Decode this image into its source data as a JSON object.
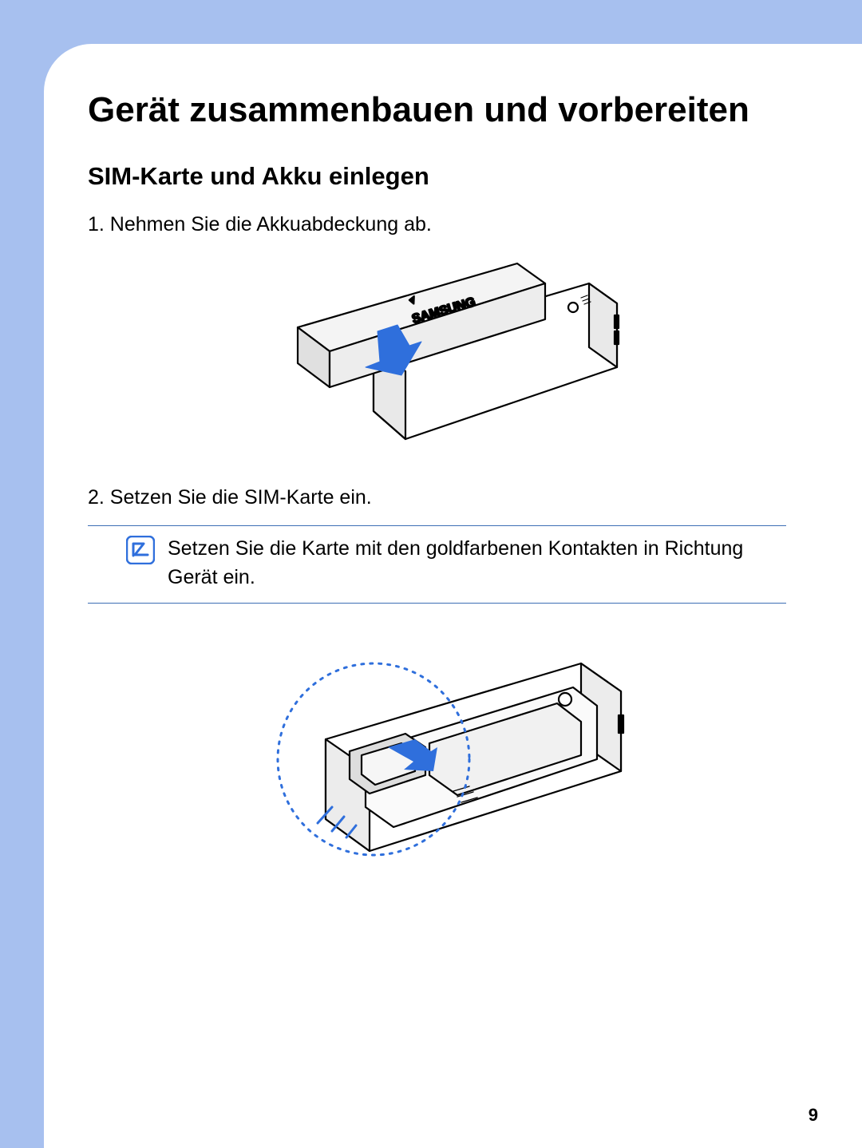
{
  "title": "Gerät zusammenbauen und vorbereiten",
  "subtitle": "SIM-Karte und Akku einlegen",
  "steps": [
    "1. Nehmen Sie die Akkuabdeckung ab.",
    "2. Setzen Sie die SIM-Karte ein."
  ],
  "note": "Setzen Sie die Karte mit den goldfarbenen Kontakten in Richtung Gerät ein.",
  "page_number": "9",
  "brand": "SAMSUNG"
}
